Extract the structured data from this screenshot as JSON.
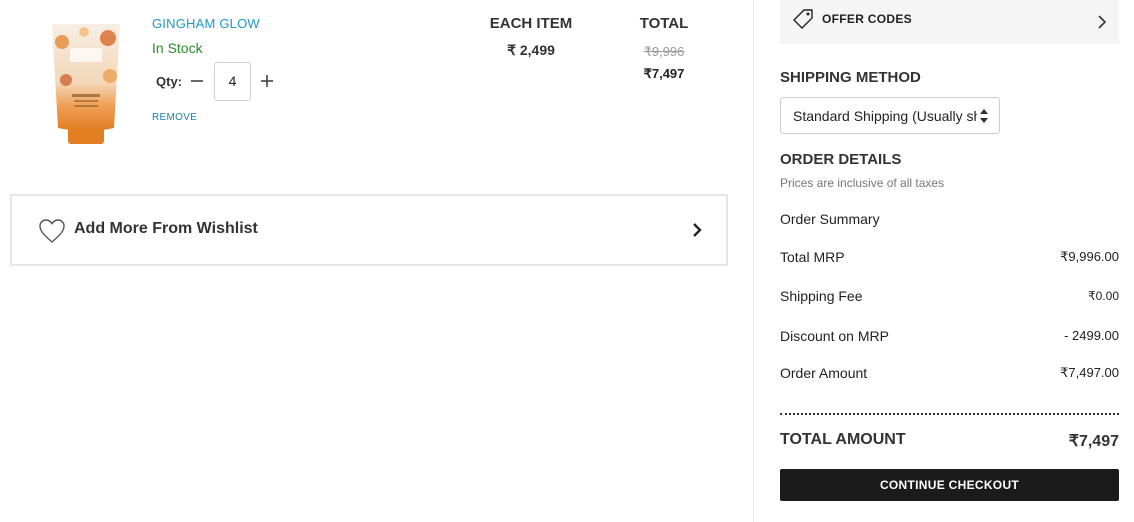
{
  "cart": {
    "item": {
      "name": "GINGHAM GLOW",
      "stock_status": "In Stock",
      "qty_label": "Qty:",
      "quantity": "4",
      "remove_label": "REMOVE",
      "each_item_header": "EACH ITEM",
      "each_item_price": "₹ 2,499",
      "total_header": "TOTAL",
      "total_original": "₹9,996",
      "total_discounted": "₹7,497"
    },
    "wishlist_label": "Add More From Wishlist"
  },
  "summary": {
    "offer_codes_label": "OFFER CODES",
    "shipping_method_title": "SHIPPING METHOD",
    "shipping_method_selected": "Standard Shipping (Usually ships in",
    "order_details_title": "ORDER DETAILS",
    "order_details_note": "Prices are inclusive of all taxes",
    "order_summary_label": "Order Summary",
    "rows": [
      {
        "label": "Total MRP",
        "value": "₹9,996.00"
      },
      {
        "label": "Shipping Fee",
        "value": "₹0.00"
      },
      {
        "label": "Discount on MRP",
        "value": "- 2499.00"
      },
      {
        "label": "Order Amount",
        "value": "₹7,497.00"
      }
    ],
    "total_amount_label": "TOTAL AMOUNT",
    "total_amount_value": "₹7,497",
    "checkout_label": "CONTINUE CHECKOUT"
  },
  "colors": {
    "link_blue": "#1a9bc7",
    "in_stock_green": "#2a8a2a",
    "checkout_bg": "#1b1b1b",
    "offer_bg": "#f5f5f5"
  },
  "icons": {
    "wishlist": "heart-icon",
    "wishlist_arrow": "chevron-right-icon",
    "offer": "tag-icon",
    "offer_arrow": "chevron-right-icon",
    "select_arrows": "sort-arrows-icon"
  }
}
